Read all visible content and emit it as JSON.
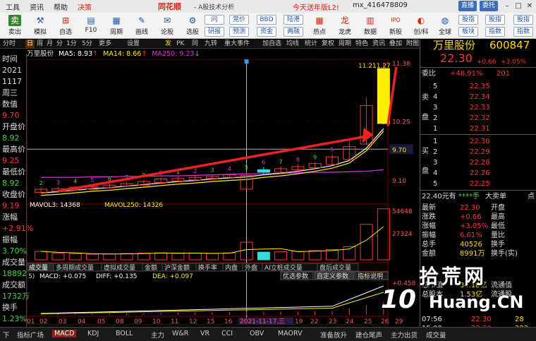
{
  "menu": {
    "items": [
      "工具",
      "资讯",
      "帮助",
      "决策"
    ],
    "brand": "同花顺",
    "title": "- A股技术分析",
    "promo": "今天送年版L2!",
    "account": "mx_416478809",
    "btn_direct": "直播",
    "btn_friend": "委托"
  },
  "toolbar": {
    "buttons": [
      "卖出",
      "模拟",
      "自选",
      "F10",
      "周期",
      "画线",
      "论股",
      "选股"
    ],
    "small_buttons": [
      "宽",
      "竞价",
      "BBD",
      "陆港",
      "研报",
      "预测",
      "资金",
      "两融"
    ],
    "right_buttons": [
      "热点",
      "龙虎",
      "数据",
      "新股",
      "创/科",
      "全球"
    ],
    "far_buttons": [
      "股指",
      "股指",
      "板块",
      "指数"
    ],
    "small_labels": [
      "问",
      "竞价",
      "BBD",
      "陆港",
      "研报",
      "预测",
      "资金",
      "两融"
    ]
  },
  "tabs": [
    "分时",
    "日",
    "周",
    "月",
    "分",
    "1分",
    "5分",
    "更多",
    "设置"
  ],
  "tabs_right": [
    "发",
    "PK",
    "同",
    "九转",
    "重大事件",
    "加自选",
    "均线",
    "统计",
    "复权",
    "周期",
    "特色",
    "资讯",
    "叠加",
    "附图",
    "更多"
  ],
  "left_panel": [
    {
      "label": "时间"
    },
    {
      "label": "2021"
    },
    {
      "label": "1117"
    },
    {
      "label": "周三"
    },
    {
      "label": "数值"
    },
    {
      "label": "9.70",
      "color": "red"
    },
    {
      "label": "开盘价"
    },
    {
      "label": "8.92",
      "color": "green"
    },
    {
      "label": "最高价"
    },
    {
      "label": "9.25",
      "color": "red"
    },
    {
      "label": "最低价"
    },
    {
      "label": "8.92",
      "color": "green"
    },
    {
      "label": "收盘价"
    },
    {
      "label": "9.19",
      "color": "red"
    },
    {
      "label": "涨幅"
    },
    {
      "label": "+2.91%",
      "color": "red"
    },
    {
      "label": "振幅"
    },
    {
      "label": "3.70%",
      "color": "green"
    },
    {
      "label": "成交量"
    },
    {
      "label": "18892",
      "color": "green"
    },
    {
      "label": "成交额"
    },
    {
      "label": "1732万",
      "color": "green"
    },
    {
      "label": "换手"
    },
    {
      "label": "1.23%",
      "color": "green"
    }
  ],
  "ma_bar": {
    "stock": "万里股份",
    "ma5": "MA5: 8.93",
    "ma14": "MA14: 8.66",
    "ma250": "MA250: 9.23"
  },
  "chart_data": {
    "type": "candlestick",
    "price_labels": [
      "11.38",
      "10.25",
      "9.70",
      "9.10"
    ],
    "top_labels": [
      "11.21",
      "11.27"
    ],
    "volume_header": {
      "mavol3": "MAVOL3: 14368",
      "mavol250": "MAVOL250: 14326"
    },
    "volume_labels": [
      "54648",
      "27324"
    ],
    "volume_tabs": [
      "成交量",
      "多周期成交量",
      "虚拟成交量",
      "金额",
      "沪深金额",
      "换手率",
      "内盘",
      "外盘",
      "AI立桩成交量",
      "盘后成交量"
    ],
    "macd_header": {
      "prefix": "5)",
      "macd": "MACD: +0.075",
      "diff": "DIFF: +0.135",
      "dea": "DEA: +0.097"
    },
    "macd_buttons": [
      "优选参数",
      "自定义参数",
      "指标说明"
    ],
    "macd_label": "+0.458",
    "x_labels": [
      "01",
      "02",
      "03",
      "04",
      "05",
      "08",
      "09",
      "10",
      "11",
      "12",
      "15",
      "16",
      "2021-11-17,三",
      "19",
      "22",
      "23",
      "24",
      "25",
      "26",
      "29"
    ],
    "candles": [
      {
        "o": 8.86,
        "c": 8.92,
        "h": 8.95,
        "l": 8.84
      },
      {
        "o": 8.88,
        "c": 8.93,
        "h": 8.96,
        "l": 8.86
      },
      {
        "o": 8.9,
        "c": 8.96,
        "h": 8.98,
        "l": 8.88
      },
      {
        "o": 8.92,
        "c": 8.97,
        "h": 9.0,
        "l": 8.9
      },
      {
        "o": 8.95,
        "c": 9.0,
        "h": 9.03,
        "l": 8.93
      },
      {
        "o": 8.98,
        "c": 9.03,
        "h": 9.06,
        "l": 8.96
      },
      {
        "o": 9.0,
        "c": 9.07,
        "h": 9.1,
        "l": 8.98
      },
      {
        "o": 9.05,
        "c": 9.12,
        "h": 9.15,
        "l": 9.03
      },
      {
        "o": 9.08,
        "c": 9.13,
        "h": 9.17,
        "l": 9.06
      },
      {
        "o": 9.1,
        "c": 9.15,
        "h": 9.18,
        "l": 9.08
      },
      {
        "o": 9.13,
        "c": 9.17,
        "h": 9.2,
        "l": 9.1
      },
      {
        "o": 9.15,
        "c": 9.2,
        "h": 9.22,
        "l": 9.12
      },
      {
        "o": 8.92,
        "c": 9.19,
        "h": 9.25,
        "l": 8.92
      },
      {
        "o": 9.3,
        "c": 9.25,
        "h": 9.35,
        "l": 9.22
      },
      {
        "o": 9.25,
        "c": 9.32,
        "h": 9.36,
        "l": 9.23
      },
      {
        "o": 9.3,
        "c": 9.36,
        "h": 9.4,
        "l": 9.28
      },
      {
        "o": 9.34,
        "c": 9.42,
        "h": 9.45,
        "l": 9.32
      },
      {
        "o": 9.4,
        "c": 9.55,
        "h": 9.6,
        "l": 9.38
      },
      {
        "o": 9.5,
        "c": 9.75,
        "h": 9.85,
        "l": 9.48
      },
      {
        "o": 9.8,
        "c": 10.55,
        "h": 10.7,
        "l": 9.78
      },
      {
        "o": 10.2,
        "c": 11.27,
        "h": 11.38,
        "l": 10.18
      }
    ],
    "volumes": [
      9000,
      7000,
      6500,
      6000,
      6200,
      6800,
      7200,
      7500,
      6900,
      7100,
      6700,
      7400,
      18892,
      8200,
      8800,
      9100,
      9800,
      11000,
      14000,
      38000,
      54648
    ],
    "ma_series": {
      "ma5": [
        8.85,
        8.87,
        8.9,
        8.93,
        8.95,
        8.98,
        9.01,
        9.04,
        9.07,
        9.09,
        9.12,
        9.14,
        9.16,
        9.2,
        9.23,
        9.27,
        9.32,
        9.38,
        9.48,
        9.72,
        10.1
      ],
      "ma250": [
        9.15,
        9.15,
        9.15,
        9.16,
        9.16,
        9.17,
        9.17,
        9.18,
        9.18,
        9.19,
        9.2,
        9.21,
        9.22,
        9.22,
        9.23,
        9.24,
        9.25,
        9.25,
        9.26,
        9.27,
        9.3
      ]
    },
    "arrow_annotation": true,
    "markers": [
      "2",
      "3",
      "4",
      "5",
      "6",
      "7",
      "8",
      "9",
      "1",
      "2",
      "3",
      "4",
      "5",
      "6",
      "7",
      "8",
      "9",
      "5"
    ]
  },
  "quote": {
    "name": "万里股份",
    "code": "600847",
    "price": "22.30",
    "change": "+0.66",
    "pct": "+3.05%",
    "wei_bi_label": "委比",
    "wei_bi": "+48.91%",
    "wei_cha": "201",
    "sell": [
      {
        "lv": "5",
        "p": "22.35"
      },
      {
        "lv": "4",
        "p": "22.34"
      },
      {
        "lv": "3",
        "p": "22.33"
      },
      {
        "lv": "2",
        "p": "22.32"
      },
      {
        "lv": "1",
        "p": "22.31"
      }
    ],
    "buy": [
      {
        "lv": "1",
        "p": "22.30"
      },
      {
        "lv": "2",
        "p": "22.29"
      },
      {
        "lv": "3",
        "p": "22.28"
      },
      {
        "lv": "4",
        "p": "22.26"
      },
      {
        "lv": "5",
        "p": "22.25"
      }
    ],
    "sell_side": "卖",
    "sell_side2": "盘",
    "buy_side": "买",
    "buy_side2": "盘",
    "info_row": "22.40元有",
    "info_mid": "****手",
    "info_right": "大卖单",
    "info_end": "点",
    "stats": [
      {
        "k": "最新",
        "v": "22.30",
        "k2": "开盘"
      },
      {
        "k": "涨跌",
        "v": "+0.66",
        "k2": "最高"
      },
      {
        "k": "涨幅",
        "v": "+3.05%",
        "k2": "最低"
      },
      {
        "k": "振幅",
        "v": "6.61%",
        "k2": "量比"
      },
      {
        "k": "总手",
        "v": "40526",
        "k2": "换手"
      },
      {
        "k": "金额",
        "v": "8991万",
        "k2": "换手(实)"
      }
    ],
    "stats2": [
      {
        "k": "总市值",
        "v": "34.18亿",
        "k2": "流通值"
      },
      {
        "k": "总股本",
        "v": "1.53亿",
        "k2": "流通股"
      }
    ],
    "time_row": {
      "t": "07:56",
      "p": "22.30",
      "v": "28"
    },
    "time_row2": {
      "t": "15:00",
      "p": "22.30",
      "v": "222"
    }
  },
  "bottom_tabs": [
    "下",
    "指标广场",
    "MACD",
    "KDJ",
    "BOLL",
    "主力",
    "W&R",
    "VR",
    "CCI",
    "OBV",
    "MAORV",
    "准备放升",
    "建仓尾声",
    "主力出货",
    "成交量"
  ],
  "watermark": {
    "t1": "拾荒网",
    "t2": "10",
    "t3": "Huang.CN"
  },
  "colors": {
    "up": "#ff3333",
    "down": "#33dd33",
    "ma5": "#ffffff",
    "ma14": "#ffee00",
    "ma250": "#dd33dd",
    "arrow": "#ee2222"
  }
}
